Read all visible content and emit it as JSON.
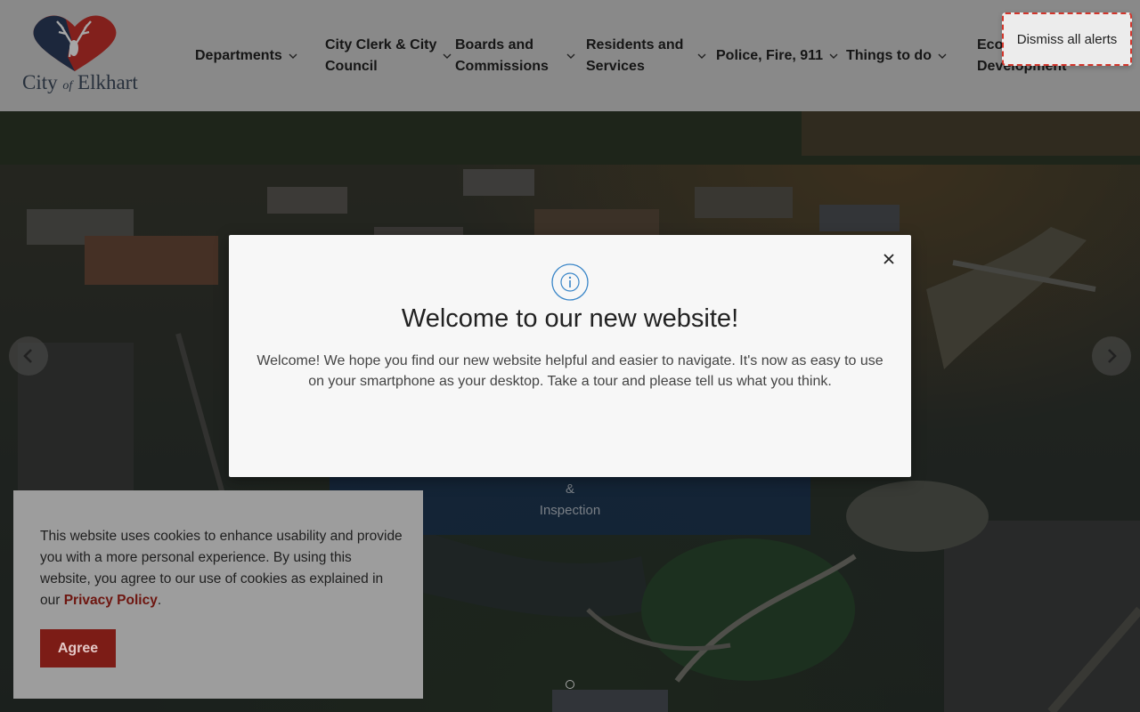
{
  "logo": {
    "text_main": "City",
    "text_of": "of",
    "text_city": "Elkhart"
  },
  "nav": {
    "departments": {
      "line1": "Departments"
    },
    "city_clerk": {
      "line1": "City Clerk & City",
      "line2": "Council"
    },
    "boards": {
      "line1": "Boards and",
      "line2": "Commissions"
    },
    "residents": {
      "line1": "Residents and",
      "line2": "Services"
    },
    "police": {
      "line1": "Police, Fire, 911"
    },
    "things": {
      "line1": "Things to do"
    },
    "economic": {
      "line1": "Economic",
      "line2": "Development"
    }
  },
  "alerts": {
    "dismiss_label": "Dismiss all alerts"
  },
  "modal": {
    "title": "Welcome to our new website!",
    "body": "Welcome! We hope you find our new website helpful and easier to navigate. It's now as easy to use on your smartphone as your desktop. Take a tour and please tell us what you think."
  },
  "quick_tile": {
    "line1": "&",
    "line2": "Inspection"
  },
  "cookie": {
    "text": "This website uses cookies to enhance usability and provide you with a more personal experience. By using this website, you agree to our use of cookies as explained in our ",
    "link": "Privacy Policy",
    "suffix": ".",
    "agree_label": "Agree"
  },
  "colors": {
    "brand_red": "#c8322b",
    "brand_navy": "#2b3d5c",
    "cookie_button": "#7c1c16",
    "alert_border": "#d2362c"
  },
  "icons": [
    "deer-heart-logo-icon",
    "chevron-down-icon",
    "close-icon",
    "info-icon",
    "chevron-left-icon",
    "chevron-right-icon",
    "slide-dot-icon"
  ]
}
